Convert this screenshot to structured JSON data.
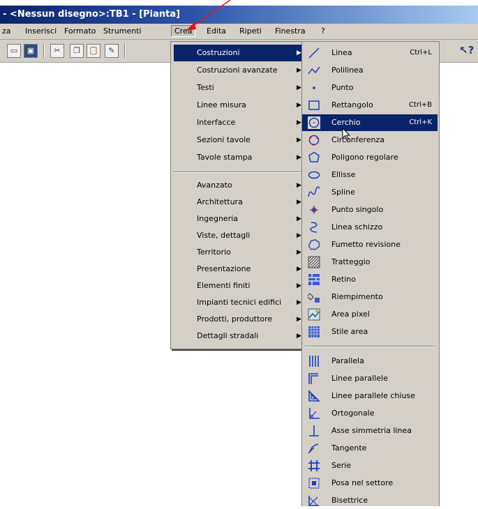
{
  "window": {
    "title": "- <Nessun disegno>:TB1 - [Pianta]"
  },
  "menubar": [
    "za",
    "Inserisci",
    "Formato",
    "Strumenti",
    "Crea",
    "Edita",
    "Ripeti",
    "Finestra",
    "?"
  ],
  "toolbar": {
    "help_label": "?"
  },
  "crea_menu": {
    "group1": [
      "Costruzioni",
      "Costruzioni avanzate",
      "Testi",
      "Linee misura",
      "Interfacce",
      "Sezioni tavole",
      "Tavole stampa"
    ],
    "group2": [
      "Avanzato",
      "Architettura",
      "Ingegneria",
      "Viste, dettagli",
      "Territorio",
      "Presentazione",
      "Elementi finiti",
      "Impianti tecnici edifici",
      "Prodotti, produttore",
      "Dettagli stradali"
    ]
  },
  "costruzioni_menu": {
    "group1": [
      {
        "label": "Linea",
        "shortcut": "Ctrl+L",
        "icon": "line-icon"
      },
      {
        "label": "Polilinea",
        "shortcut": "",
        "icon": "polyline-icon"
      },
      {
        "label": "Punto",
        "shortcut": "",
        "icon": "point-icon"
      },
      {
        "label": "Rettangolo",
        "shortcut": "Ctrl+B",
        "icon": "rectangle-icon"
      },
      {
        "label": "Cerchio",
        "shortcut": "Ctrl+K",
        "icon": "circle-icon"
      },
      {
        "label": "Circonferenza",
        "shortcut": "",
        "icon": "circumference-icon"
      },
      {
        "label": "Poligono regolare",
        "shortcut": "",
        "icon": "polygon-icon"
      },
      {
        "label": "Ellisse",
        "shortcut": "",
        "icon": "ellipse-icon"
      },
      {
        "label": "Spline",
        "shortcut": "",
        "icon": "spline-icon"
      },
      {
        "label": "Punto singolo",
        "shortcut": "",
        "icon": "single-point-icon"
      },
      {
        "label": "Linea schizzo",
        "shortcut": "",
        "icon": "sketch-line-icon"
      },
      {
        "label": "Fumetto revisione",
        "shortcut": "",
        "icon": "revision-cloud-icon"
      },
      {
        "label": "Tratteggio",
        "shortcut": "",
        "icon": "hatch-icon"
      },
      {
        "label": "Retino",
        "shortcut": "",
        "icon": "pattern-icon"
      },
      {
        "label": "Riempimento",
        "shortcut": "",
        "icon": "fill-icon"
      },
      {
        "label": "Area pixel",
        "shortcut": "",
        "icon": "pixel-area-icon"
      },
      {
        "label": "Stile area",
        "shortcut": "",
        "icon": "area-style-icon"
      }
    ],
    "group2": [
      {
        "label": "Parallela",
        "icon": "parallel-icon"
      },
      {
        "label": "Linee parallele",
        "icon": "parallel-lines-icon"
      },
      {
        "label": "Linee parallele chiuse",
        "icon": "closed-parallel-lines-icon"
      },
      {
        "label": "Ortogonale",
        "icon": "orthogonal-icon"
      },
      {
        "label": "Asse simmetria linea",
        "icon": "symmetry-axis-icon"
      },
      {
        "label": "Tangente",
        "icon": "tangent-icon"
      },
      {
        "label": "Serie",
        "icon": "series-icon"
      },
      {
        "label": "Posa nel settore",
        "icon": "sector-placement-icon"
      },
      {
        "label": "Bisettrice",
        "icon": "bisector-icon"
      }
    ]
  },
  "colors": {
    "highlight": "#0a246a",
    "menu_bg": "#d4d0c8",
    "annotation_arrow": "#e0151b"
  }
}
